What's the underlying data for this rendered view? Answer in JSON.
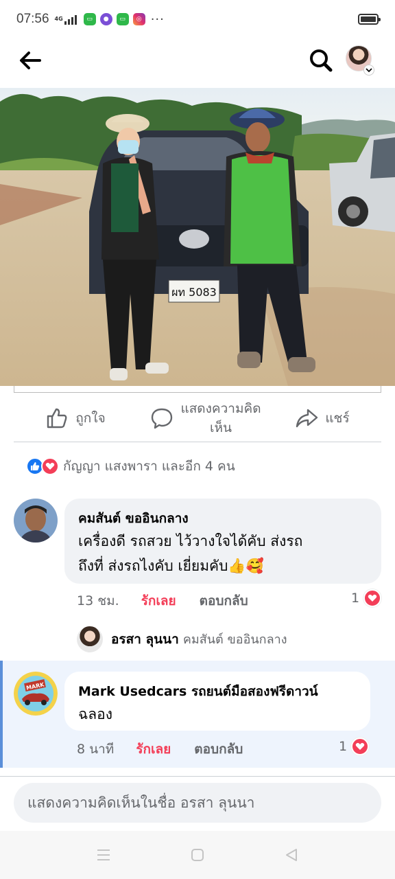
{
  "status_bar": {
    "time": "07:56",
    "network": "4G",
    "overflow": "···",
    "battery_level": 1.0,
    "app_icons": [
      "line-icon",
      "bot-icon",
      "chat-icon",
      "instagram-icon"
    ]
  },
  "top_nav": {
    "icons": [
      "back-arrow-icon",
      "search-icon",
      "profile-avatar",
      "chevron-down-icon"
    ]
  },
  "actions": {
    "like": "ถูกใจ",
    "comment_line1": "แสดงความคิด",
    "comment_line2": "เห็น",
    "share": "แชร์"
  },
  "reactions": {
    "summary": "กัญญา แสงพารา และอีก 4 คน"
  },
  "photo": {
    "license_plate": "ผท 5083"
  },
  "comments": [
    {
      "name": "คมสันต์ ขออินกลาง",
      "text_line1": "เครื่องดี รถสวย ไว้วางใจได้คับ ส่งรถ",
      "text_line2": "ถึงที่ ส่งรถไงคับ เยี่ยมคับ👍🥰",
      "time": "13 ชม.",
      "love": "รักเลย",
      "reply": "ตอบกลับ",
      "reaction_count": "1"
    },
    {
      "name": "Mark Usedcars รถยนต์มือสองฟรีดาวน์",
      "text_line1": "ฉลอง",
      "time": "8 นาที",
      "love": "รักเลย",
      "reply": "ตอบกลับ",
      "reaction_count": "1",
      "logo_text": "MARK"
    }
  ],
  "reply_preview": {
    "name": "อรสา ลุนนา",
    "to": "คมสันต์ ขออินกลาง"
  },
  "composer": {
    "placeholder": "แสดงความคิดเห็นในชื่อ อรสา ลุนนา"
  },
  "colors": {
    "love": "#f33e58",
    "like": "#1877f2",
    "bubble": "#f0f2f5",
    "muted": "#65676b"
  }
}
